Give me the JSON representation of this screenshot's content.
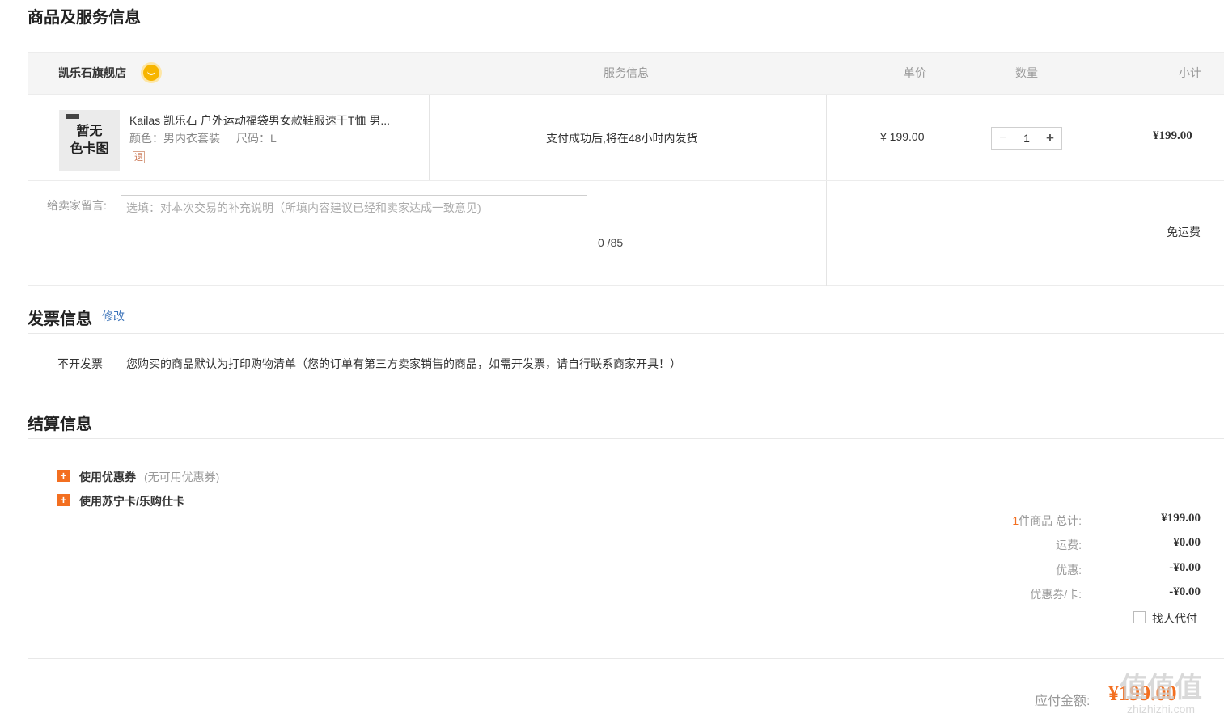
{
  "section_titles": {
    "products": "商品及服务信息",
    "invoice": "发票信息",
    "settlement": "结算信息"
  },
  "table_header": {
    "shop_name": "凯乐石旗舰店",
    "service": "服务信息",
    "unit_price": "单价",
    "quantity": "数量",
    "subtotal": "小计"
  },
  "product": {
    "thumb_text_line1": "暂无",
    "thumb_text_line2": "色卡图",
    "title": "Kailas 凯乐石 户外运动福袋男女款鞋服速干T恤 男...",
    "attr_color": "颜色：男内衣套装",
    "attr_size": "尺码：L",
    "refund_tag": "退",
    "service_text": "支付成功后,将在48小时内发货",
    "unit_price": "¥ 199.00",
    "quantity": "1",
    "minus": "−",
    "plus": "+",
    "subtotal": "¥199.00"
  },
  "message": {
    "label": "给卖家留言:",
    "placeholder": "选填：对本次交易的补充说明（所填内容建议已经和卖家达成一致意见)",
    "counter": "0 /85"
  },
  "shipping_free": "免运费",
  "invoice": {
    "edit_link": "修改",
    "type": "不开发票",
    "desc": "您购买的商品默认为打印购物清单（您的订单有第三方卖家销售的商品，如需开发票，请自行联系商家开具！）"
  },
  "settlement": {
    "coupon_label": "使用优惠券",
    "coupon_note": "(无可用优惠券)",
    "card_label": "使用苏宁卡/乐购仕卡",
    "count_prefix": "1",
    "count_label": "件商品 总计:",
    "total": "¥199.00",
    "freight_label": "运费:",
    "freight": "¥0.00",
    "discount_label": "优惠:",
    "discount": "-¥0.00",
    "coupon_card_label": "优惠券/卡:",
    "coupon_card": "-¥0.00",
    "pay_for_me": "找人代付",
    "payable_label": "应付金额:",
    "payable": "¥199.00"
  },
  "watermark": {
    "big": "值值值",
    "small": "zhizhizhi.com"
  },
  "colors": {
    "accent_orange": "#f36f20",
    "link_blue": "#3b73b9",
    "header_bg": "#f5f5f5"
  }
}
